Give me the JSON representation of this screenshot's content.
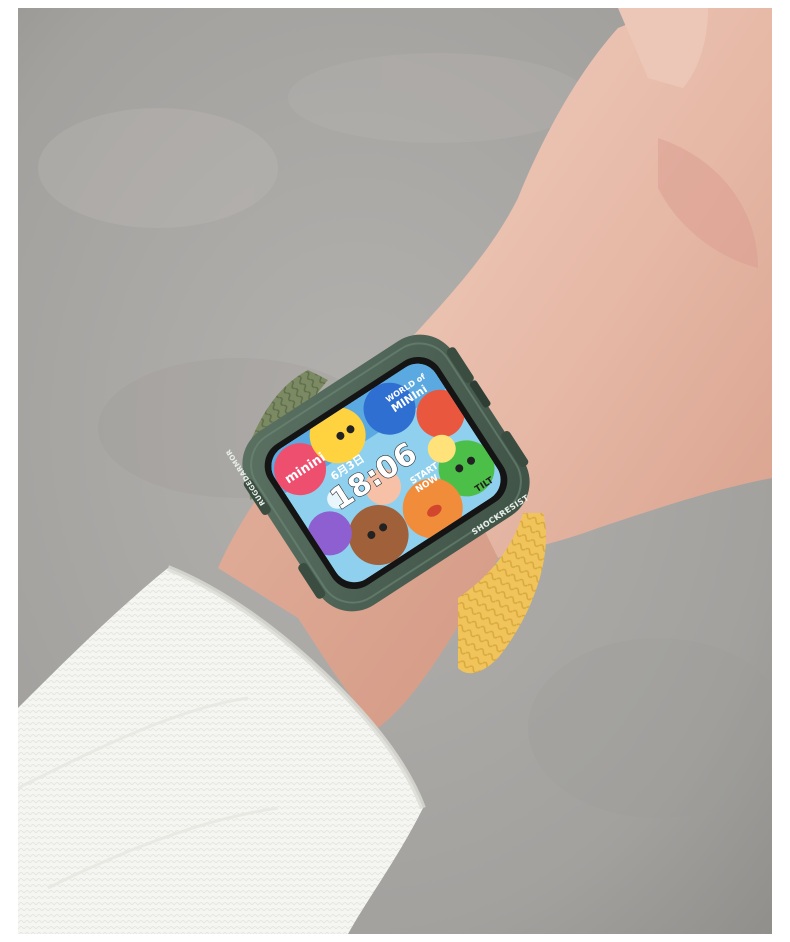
{
  "photo": {
    "subject": "wrist-watch-photo",
    "case_label_left": "RUGGEDARMOR",
    "case_label_right": "SHOCKRESIST",
    "watch_face": {
      "time": "18:06",
      "date": "6月3日",
      "sticker_minini": "minini",
      "sticker_world": "WORLD of",
      "sticker_minini2": "MINIni",
      "sticker_start": "START",
      "sticker_now": "NOW",
      "sticker_tilt": "TILT"
    }
  },
  "colors": {
    "background": "#a9a7a4",
    "case_green": "#4a5f52",
    "band_yellow": "#f0c45a",
    "band_olive": "#7b8a62",
    "sleeve_white": "#f4f4f1",
    "skin": "#e8bfae"
  }
}
